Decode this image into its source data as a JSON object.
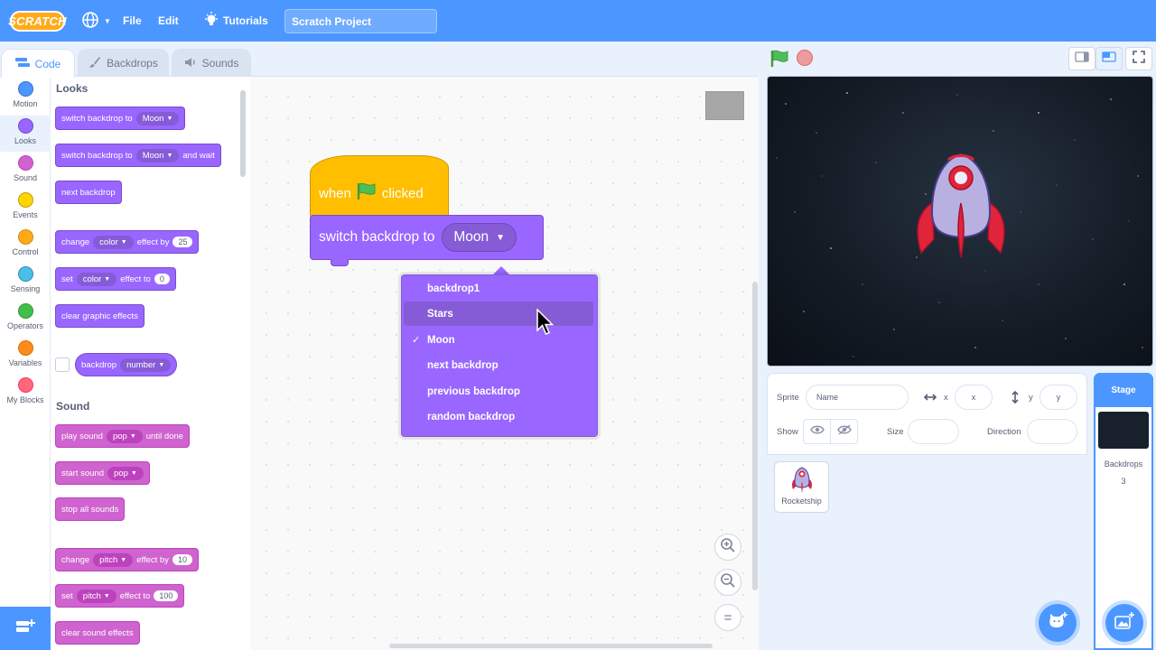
{
  "menubar": {
    "logo": "SCRATCH",
    "file": "File",
    "edit": "Edit",
    "tutorials": "Tutorials",
    "project_title": "Scratch Project"
  },
  "tabs": {
    "code": "Code",
    "backdrops": "Backdrops",
    "sounds": "Sounds"
  },
  "categories": [
    {
      "label": "Motion",
      "color": "#4c97ff"
    },
    {
      "label": "Looks",
      "color": "#9966ff"
    },
    {
      "label": "Sound",
      "color": "#cf63cf"
    },
    {
      "label": "Events",
      "color": "#ffd500"
    },
    {
      "label": "Control",
      "color": "#ffab19"
    },
    {
      "label": "Sensing",
      "color": "#4cbfe6"
    },
    {
      "label": "Operators",
      "color": "#40bf4a"
    },
    {
      "label": "Variables",
      "color": "#ff8c1a"
    },
    {
      "label": "My Blocks",
      "color": "#ff6680"
    }
  ],
  "palette": {
    "looks_title": "Looks",
    "sound_title": "Sound",
    "b1": {
      "text": "switch backdrop to",
      "drop": "Moon"
    },
    "b2": {
      "text": "switch backdrop to",
      "drop": "Moon",
      "suffix": "and wait"
    },
    "b3": {
      "text": "next backdrop"
    },
    "b4": {
      "text": "change",
      "drop": "color",
      "mid": "effect by",
      "num": "25"
    },
    "b5": {
      "text": "set",
      "drop": "color",
      "mid": "effect to",
      "num": "0"
    },
    "b6": {
      "text": "clear graphic effects"
    },
    "b7": {
      "text": "backdrop",
      "drop": "number"
    },
    "s1": {
      "text": "play sound",
      "drop": "pop",
      "suffix": "until done"
    },
    "s2": {
      "text": "start sound",
      "drop": "pop"
    },
    "s3": {
      "text": "stop all sounds"
    },
    "s4": {
      "text": "change",
      "drop": "pitch",
      "mid": "effect by",
      "num": "10"
    },
    "s5": {
      "text": "set",
      "drop": "pitch",
      "mid": "effect to",
      "num": "100"
    },
    "s6": {
      "text": "clear sound effects"
    }
  },
  "script": {
    "hat_when": "when",
    "hat_clicked": "clicked",
    "block_text": "switch backdrop to",
    "block_value": "Moon"
  },
  "dropdown": {
    "items": [
      "backdrop1",
      "Stars",
      "Moon",
      "next backdrop",
      "previous backdrop",
      "random backdrop"
    ],
    "checked": "✓"
  },
  "zoom": {
    "in": "+",
    "out": "−",
    "reset": "="
  },
  "sprite_info": {
    "sprite_label": "Sprite",
    "name_placeholder": "Name",
    "x_label": "x",
    "x_placeholder": "x",
    "y_label": "y",
    "y_placeholder": "y",
    "show_label": "Show",
    "size_label": "Size",
    "direction_label": "Direction"
  },
  "sprites": [
    {
      "name": "Rocketship"
    }
  ],
  "stage_pane": {
    "title": "Stage",
    "backdrops_label": "Backdrops",
    "backdrops_count": "3"
  }
}
